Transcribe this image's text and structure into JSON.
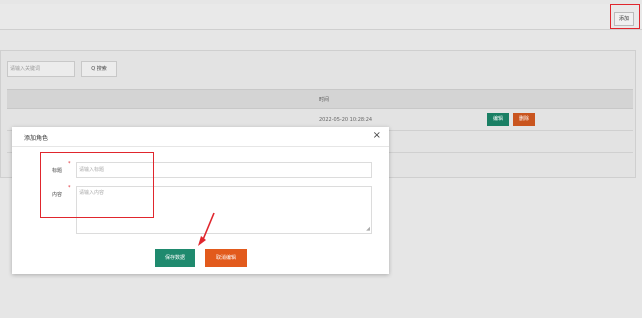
{
  "colors": {
    "highlight_red": "#e0262d",
    "save_green": "#1f8a6e",
    "cancel_orange": "#e25a1c",
    "edit_green": "#1a7f64",
    "delete_orange": "#c9551f"
  },
  "header": {
    "add_button_label": "添加"
  },
  "search": {
    "placeholder": "请输入关键词",
    "button_label": "Q 搜索"
  },
  "table": {
    "columns": [
      "时间"
    ],
    "rows": [
      {
        "time": "2022-05-20 10:28:24",
        "edit_label": "编辑",
        "delete_label": "删除"
      }
    ]
  },
  "modal": {
    "title": "添加角色",
    "close_glyph": "×",
    "fields": {
      "title_label": "标题",
      "title_placeholder": "请输入标题",
      "content_label": "内容",
      "content_placeholder": "请输入内容"
    },
    "save_label": "保存数据",
    "cancel_label": "取消编辑"
  },
  "icons": [
    "search-icon",
    "close-icon",
    "resize-handle-icon",
    "arrow-annotation"
  ]
}
